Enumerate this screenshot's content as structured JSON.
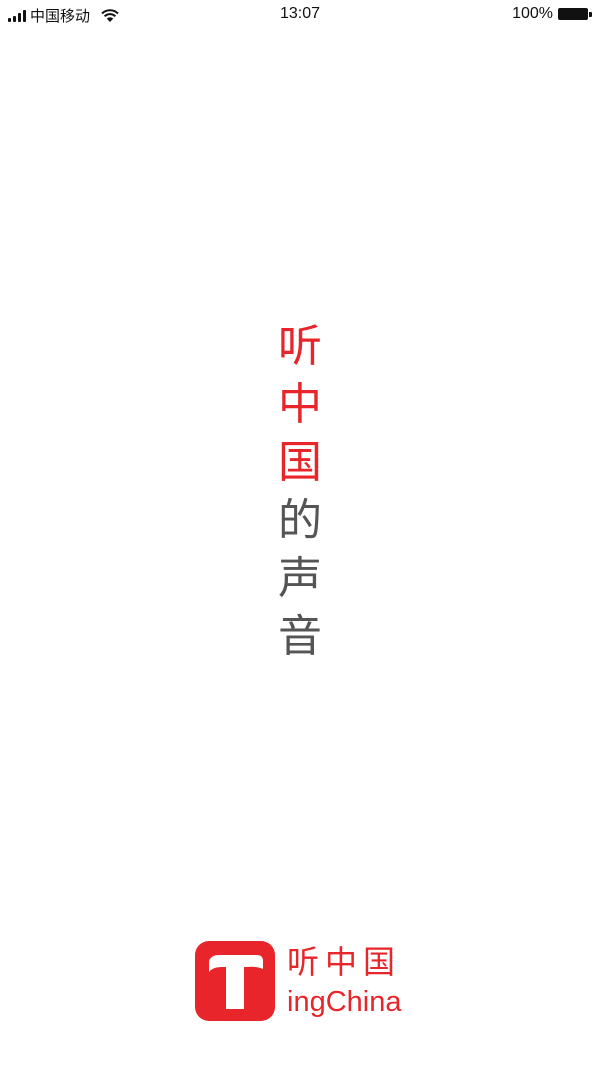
{
  "status_bar": {
    "carrier": "中国移动",
    "time": "13:07",
    "battery": "100%"
  },
  "slogan": {
    "chars": [
      {
        "char": "听",
        "color": "#e8252b"
      },
      {
        "char": "中",
        "color": "#e8252b"
      },
      {
        "char": "国",
        "color": "#e8252b"
      },
      {
        "char": "的",
        "color": "#555555"
      },
      {
        "char": "声",
        "color": "#555555"
      },
      {
        "char": "音",
        "color": "#555555"
      }
    ]
  },
  "logo": {
    "icon": "letter-t-logo-icon",
    "chinese_name": "听中国",
    "english_name": "ingChina",
    "brand_color": "#e8252b"
  }
}
